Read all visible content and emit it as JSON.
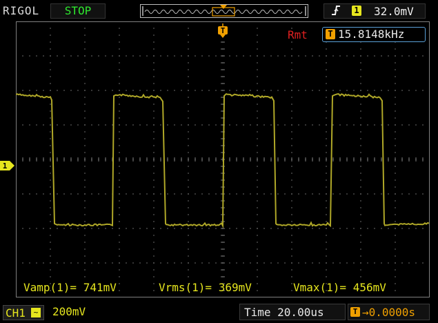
{
  "header": {
    "brand": "RIGOL",
    "run_state": "STOP",
    "trigger": {
      "edge_icon": "rising-edge-icon",
      "channel": "1",
      "level": "32.0mV"
    }
  },
  "screen": {
    "trigger_position_icon": "T",
    "rmt": "Rmt",
    "frequency_icon": "T",
    "frequency": "15.8148kHz",
    "channel_marker": "1"
  },
  "measurements": {
    "vamp": "Vamp(1)= 741mV",
    "vrms": "Vrms(1)= 369mV",
    "vmax": "Vmax(1)= 456mV"
  },
  "footer": {
    "channel": "CH1",
    "coupling_icon": "~",
    "vertical_scale": "200mV",
    "time": "Time 20.00us",
    "offset_icon": "T",
    "offset": "→0.0000s"
  },
  "colors": {
    "trace": "#b0a828",
    "grid": "#808080",
    "accent": "#e6e61e",
    "orange": "#f0a000"
  }
}
